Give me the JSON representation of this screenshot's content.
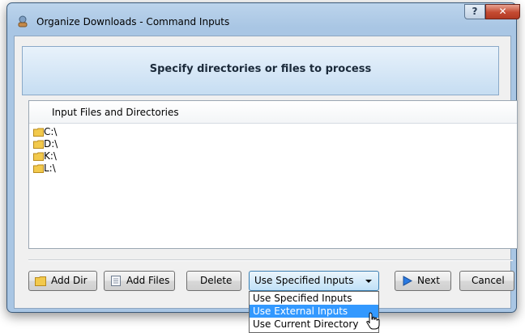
{
  "window": {
    "title": "Organize Downloads - Command Inputs",
    "help_glyph": "?",
    "close_glyph": "✕",
    "icon": "app-icon"
  },
  "banner": {
    "text": "Specify directories or files to process"
  },
  "list": {
    "header": "Input Files and Directories",
    "items": [
      {
        "label": "C:\\",
        "icon": "folder-icon"
      },
      {
        "label": "D:\\",
        "icon": "folder-icon"
      },
      {
        "label": "K:\\",
        "icon": "folder-icon"
      },
      {
        "label": "L:\\",
        "icon": "folder-icon"
      }
    ]
  },
  "buttons": {
    "add_dir": "Add Dir",
    "add_files": "Add Files",
    "delete": "Delete",
    "next": "Next",
    "cancel": "Cancel"
  },
  "combo": {
    "selected": "Use Specified Inputs",
    "options": [
      {
        "label": "Use Specified Inputs",
        "highlighted": false
      },
      {
        "label": "Use External Inputs",
        "highlighted": true
      },
      {
        "label": "Use Current Directory",
        "highlighted": false
      }
    ]
  },
  "colors": {
    "highlight": "#3399ff",
    "folder": "#f2c94c",
    "banner_text": "#1b2a3a",
    "next_arrow": "#2a7ae2"
  }
}
